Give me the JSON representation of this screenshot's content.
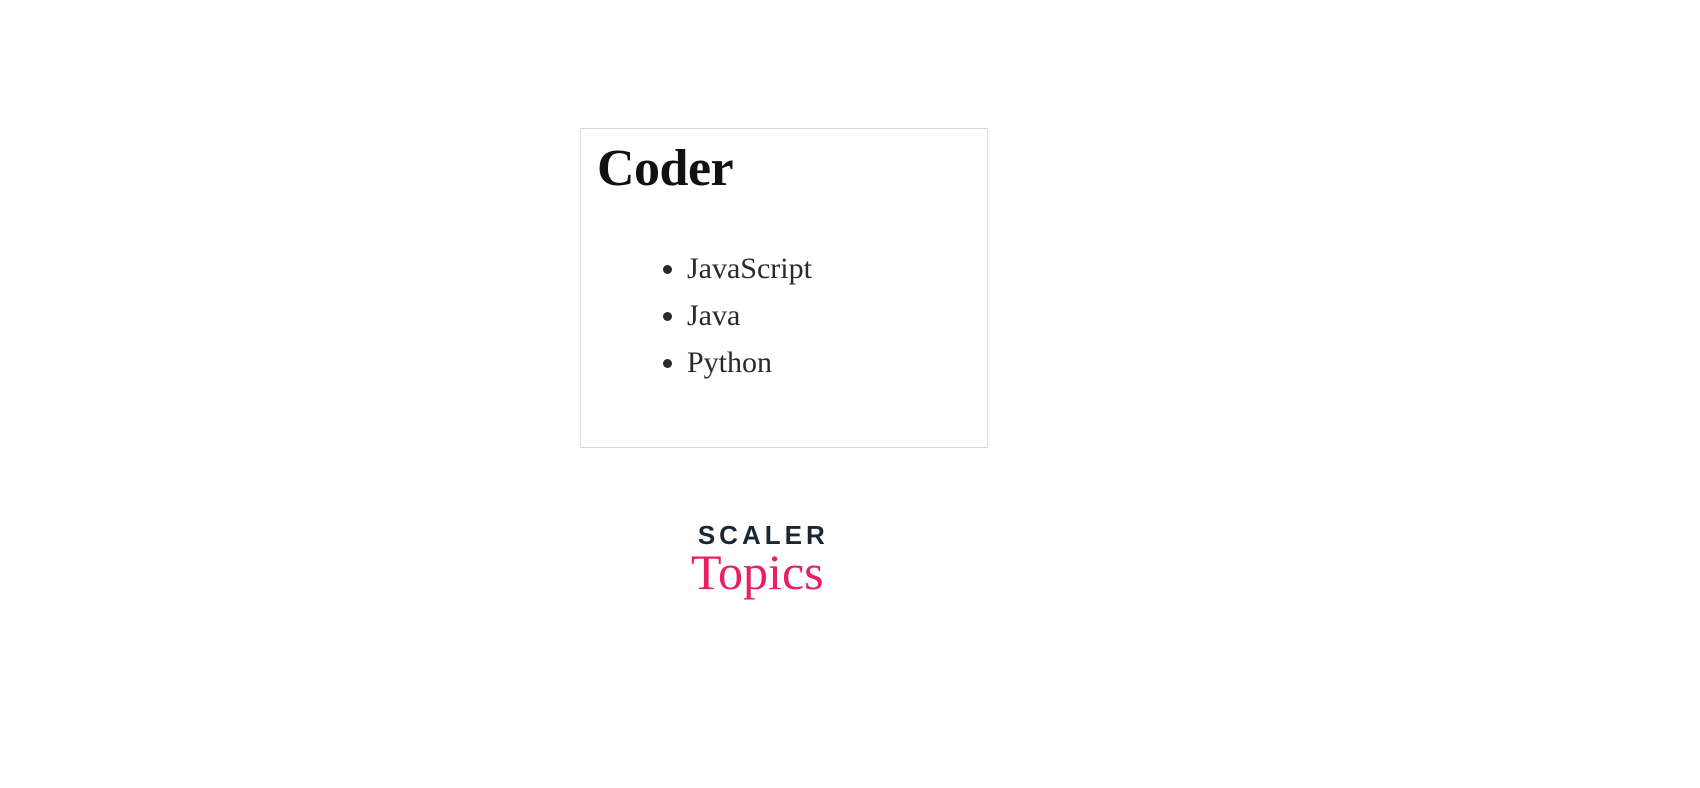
{
  "content": {
    "heading": "Coder",
    "items": [
      "JavaScript",
      "Java",
      "Python"
    ]
  },
  "logo": {
    "line1": "SCALER",
    "line2": "Topics"
  }
}
